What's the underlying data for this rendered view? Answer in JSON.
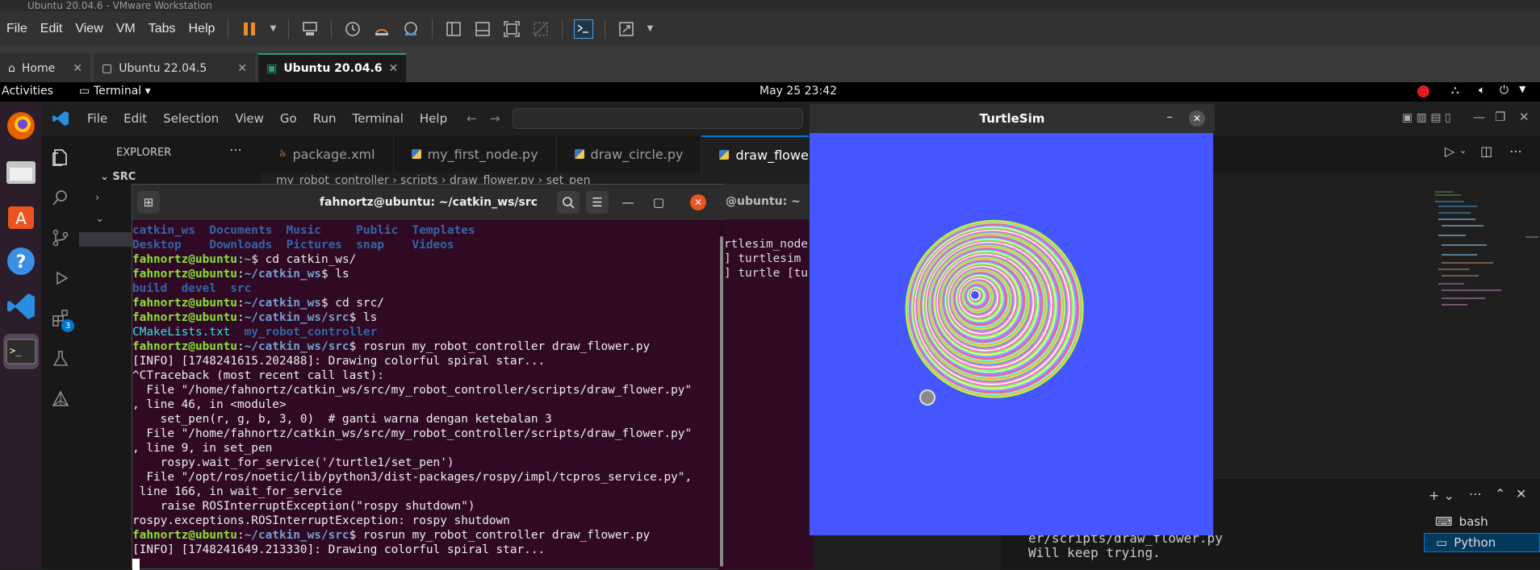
{
  "vm": {
    "title": "Ubuntu 20.04.6 - VMware Workstation",
    "menu": [
      "File",
      "Edit",
      "View",
      "VM",
      "Tabs",
      "Help"
    ],
    "tabs": [
      {
        "label": "Home",
        "active": false
      },
      {
        "label": "Ubuntu 22.04.5",
        "active": false
      },
      {
        "label": "Ubuntu 20.04.6",
        "active": true
      }
    ]
  },
  "ubuntu": {
    "activities": "Activities",
    "app_menu": "Terminal",
    "clock": "May 25  23:42"
  },
  "vscode": {
    "menu": [
      "File",
      "Edit",
      "Selection",
      "View",
      "Go",
      "Run",
      "Terminal",
      "Help"
    ],
    "explorer_title": "EXPLORER",
    "tree_root": "SRC",
    "tabs": [
      {
        "label": "package.xml",
        "icon": "xml-icon",
        "active": false
      },
      {
        "label": "my_first_node.py",
        "icon": "python-icon",
        "active": false
      },
      {
        "label": "draw_circle.py",
        "icon": "python-icon",
        "active": false
      },
      {
        "label": "draw_flower.py",
        "icon": "python-icon",
        "active": true
      }
    ],
    "breadcrumb": [
      "my_robot_controller",
      "scripts",
      "draw_flower.py",
      "set_pen"
    ],
    "extensions_badge": "3",
    "panel_terminals": [
      "bash",
      "Python"
    ],
    "panel_lines": [
      "er/scripts/draw_flower.py",
      "Will keep trying."
    ]
  },
  "terminal": {
    "title": "fahnortz@ubuntu: ~/catkin_ws/src",
    "lines": [
      [
        {
          "t": "catkin_ws  Documents  Music     Public  Templates",
          "c": "dir"
        }
      ],
      [
        {
          "t": "Desktop    Downloads  Pictures  snap    Videos",
          "c": "dir"
        }
      ],
      [
        {
          "t": "fahnortz@ubuntu",
          "c": "g"
        },
        {
          "t": ":",
          "c": ""
        },
        {
          "t": "~",
          "c": "b"
        },
        {
          "t": "$ cd catkin_ws/",
          "c": ""
        }
      ],
      [
        {
          "t": "fahnortz@ubuntu",
          "c": "g"
        },
        {
          "t": ":",
          "c": ""
        },
        {
          "t": "~/catkin_ws",
          "c": "b"
        },
        {
          "t": "$ ls",
          "c": ""
        }
      ],
      [
        {
          "t": "build  devel  src",
          "c": "dir"
        }
      ],
      [
        {
          "t": "fahnortz@ubuntu",
          "c": "g"
        },
        {
          "t": ":",
          "c": ""
        },
        {
          "t": "~/catkin_ws",
          "c": "b"
        },
        {
          "t": "$ cd src/",
          "c": ""
        }
      ],
      [
        {
          "t": "fahnortz@ubuntu",
          "c": "g"
        },
        {
          "t": ":",
          "c": ""
        },
        {
          "t": "~/catkin_ws/src",
          "c": "b"
        },
        {
          "t": "$ ls",
          "c": ""
        }
      ],
      [
        {
          "t": "CMakeLists.txt",
          "c": "cy"
        },
        {
          "t": "  ",
          "c": ""
        },
        {
          "t": "my_robot_controller",
          "c": "dir"
        }
      ],
      [
        {
          "t": "fahnortz@ubuntu",
          "c": "g"
        },
        {
          "t": ":",
          "c": ""
        },
        {
          "t": "~/catkin_ws/src",
          "c": "b"
        },
        {
          "t": "$ rosrun my_robot_controller draw_flower.py",
          "c": ""
        }
      ],
      [
        {
          "t": "[INFO] [1748241615.202488]: Drawing colorful spiral star...",
          "c": ""
        }
      ],
      [
        {
          "t": "^CTraceback (most recent call last):",
          "c": ""
        }
      ],
      [
        {
          "t": "  File \"/home/fahnortz/catkin_ws/src/my_robot_controller/scripts/draw_flower.py\"",
          "c": ""
        }
      ],
      [
        {
          "t": ", line 46, in <module>",
          "c": ""
        }
      ],
      [
        {
          "t": "    set_pen(r, g, b, 3, 0)  # ganti warna dengan ketebalan 3",
          "c": ""
        }
      ],
      [
        {
          "t": "  File \"/home/fahnortz/catkin_ws/src/my_robot_controller/scripts/draw_flower.py\"",
          "c": ""
        }
      ],
      [
        {
          "t": ", line 9, in set_pen",
          "c": ""
        }
      ],
      [
        {
          "t": "    rospy.wait_for_service('/turtle1/set_pen')",
          "c": ""
        }
      ],
      [
        {
          "t": "  File \"/opt/ros/noetic/lib/python3/dist-packages/rospy/impl/tcpros_service.py\",",
          "c": ""
        }
      ],
      [
        {
          "t": " line 166, in wait_for_service",
          "c": ""
        }
      ],
      [
        {
          "t": "    raise ROSInterruptException(\"rospy shutdown\")",
          "c": ""
        }
      ],
      [
        {
          "t": "rospy.exceptions.ROSInterruptException: rospy shutdown",
          "c": ""
        }
      ],
      [
        {
          "t": "fahnortz@ubuntu",
          "c": "g"
        },
        {
          "t": ":",
          "c": ""
        },
        {
          "t": "~/catkin_ws/src",
          "c": "b"
        },
        {
          "t": "$ rosrun my_robot_controller draw_flower.py",
          "c": ""
        }
      ],
      [
        {
          "t": "[INFO] [1748241649.213330]: Drawing colorful spiral star...",
          "c": ""
        }
      ]
    ]
  },
  "terminal2": {
    "title": "@ubuntu: ~",
    "lines": [
      "rtlesim_node",
      "] turtlesim v",
      "] turtle [tur"
    ]
  },
  "turtlesim": {
    "title": "TurtleSim",
    "background": "#4556ff"
  }
}
